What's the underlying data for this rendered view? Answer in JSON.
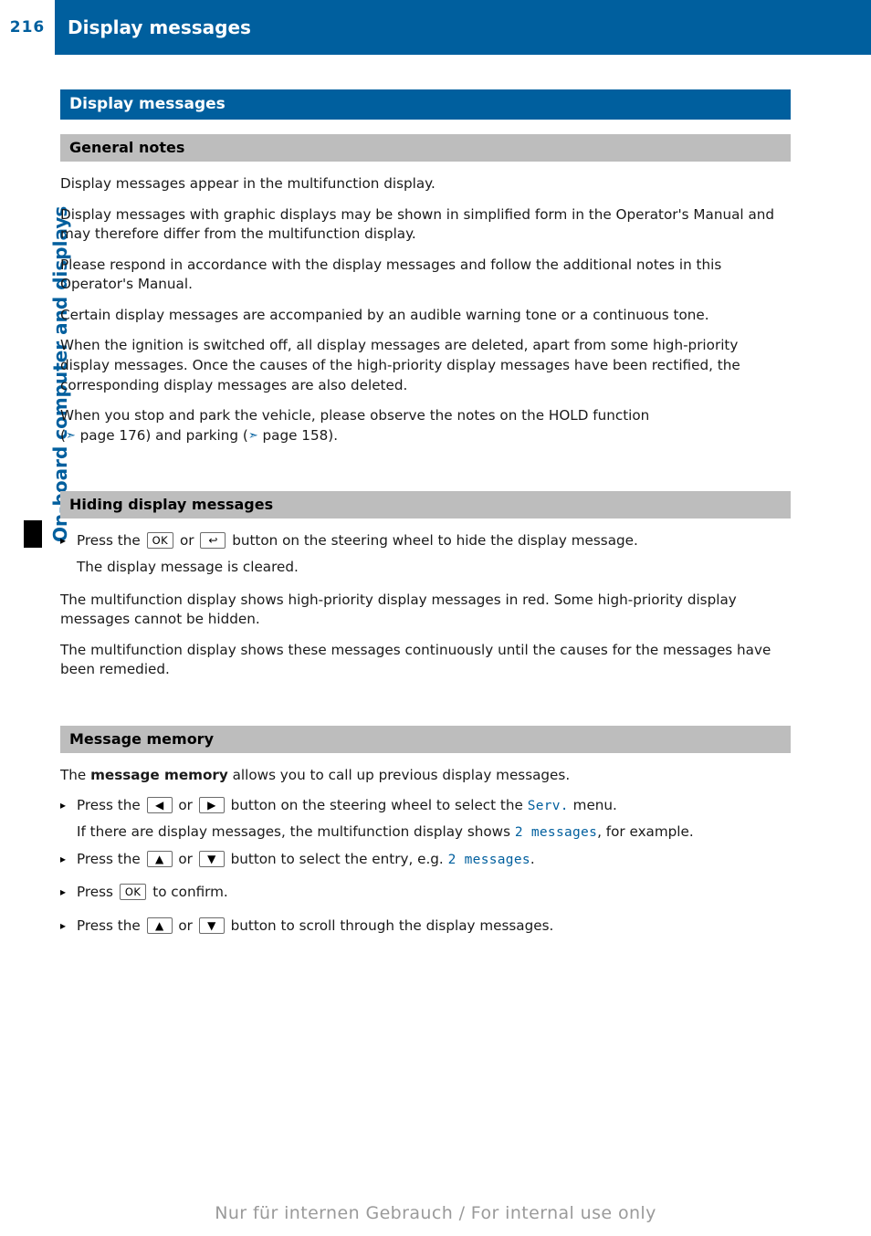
{
  "header": {
    "page_number": "216",
    "title": "Display messages"
  },
  "side_tab": {
    "label": "On-board computer and displays"
  },
  "sections": {
    "main_title": "Display messages",
    "general_notes": {
      "heading": "General notes",
      "paragraphs": [
        "Display messages appear in the multifunction display.",
        "Display messages with graphic displays may be shown in simplified form in the Operator's Manual and may therefore differ from the multifunction display.",
        "Please respond in accordance with the display messages and follow the additional notes in this Operator's Manual.",
        "Certain display messages are accompanied by an audible warning tone or a continuous tone.",
        "When the ignition is switched off, all display messages are deleted, apart from some high-priority display messages. Once the causes of the high-priority display messages have been rectified, the corresponding display messages are also deleted."
      ],
      "hold_note_part1": "When you stop and park the vehicle, please observe the notes on the HOLD function",
      "hold_note_part2_pre": "(",
      "hold_note_ref1": "page 176",
      "hold_note_mid": ") and parking (",
      "hold_note_ref2": "page 158",
      "hold_note_end": ")."
    },
    "hiding": {
      "heading": "Hiding display messages",
      "step1_pre": "Press the",
      "step1_key_ok": "OK",
      "step1_or": "or",
      "step1_key_back": "back-arrow-icon",
      "step1_post": "button on the steering wheel to hide the display message.",
      "step1_sub": "The display message is cleared.",
      "paragraphs": [
        "The multifunction display shows high-priority display messages in red. Some high-priority display messages cannot be hidden.",
        "The multifunction display shows these messages continuously until the causes for the messages have been remedied."
      ]
    },
    "message_memory": {
      "heading": "Message memory",
      "intro_pre": "The ",
      "intro_bold": "message memory",
      "intro_post": " allows you to call up previous display messages.",
      "step1_pre": "Press the",
      "step1_key_left": "◀",
      "step1_or": "or",
      "step1_key_right": "▶",
      "step1_mid": "button on the steering wheel to select the",
      "step1_menu": "Serv.",
      "step1_post": "menu.",
      "step1_sub_pre": "If there are display messages, the multifunction display shows",
      "step1_sub_value": "2 messages",
      "step1_sub_post": ", for example.",
      "step2_pre": "Press the",
      "step2_key_up": "▲",
      "step2_or": "or",
      "step2_key_down": "▼",
      "step2_mid": "button to select the entry, e.g.",
      "step2_value": "2 messages",
      "step2_post": ".",
      "step3_pre": "Press",
      "step3_key_ok": "OK",
      "step3_post": "to confirm.",
      "step4_pre": "Press the",
      "step4_key_up": "▲",
      "step4_or": "or",
      "step4_key_down": "▼",
      "step4_post": "button to scroll through the display messages."
    }
  },
  "footer": {
    "text": "Nur für internen Gebrauch / For internal use only"
  },
  "colors": {
    "brand_blue": "#005f9e",
    "band_gray": "#bdbdbd"
  }
}
